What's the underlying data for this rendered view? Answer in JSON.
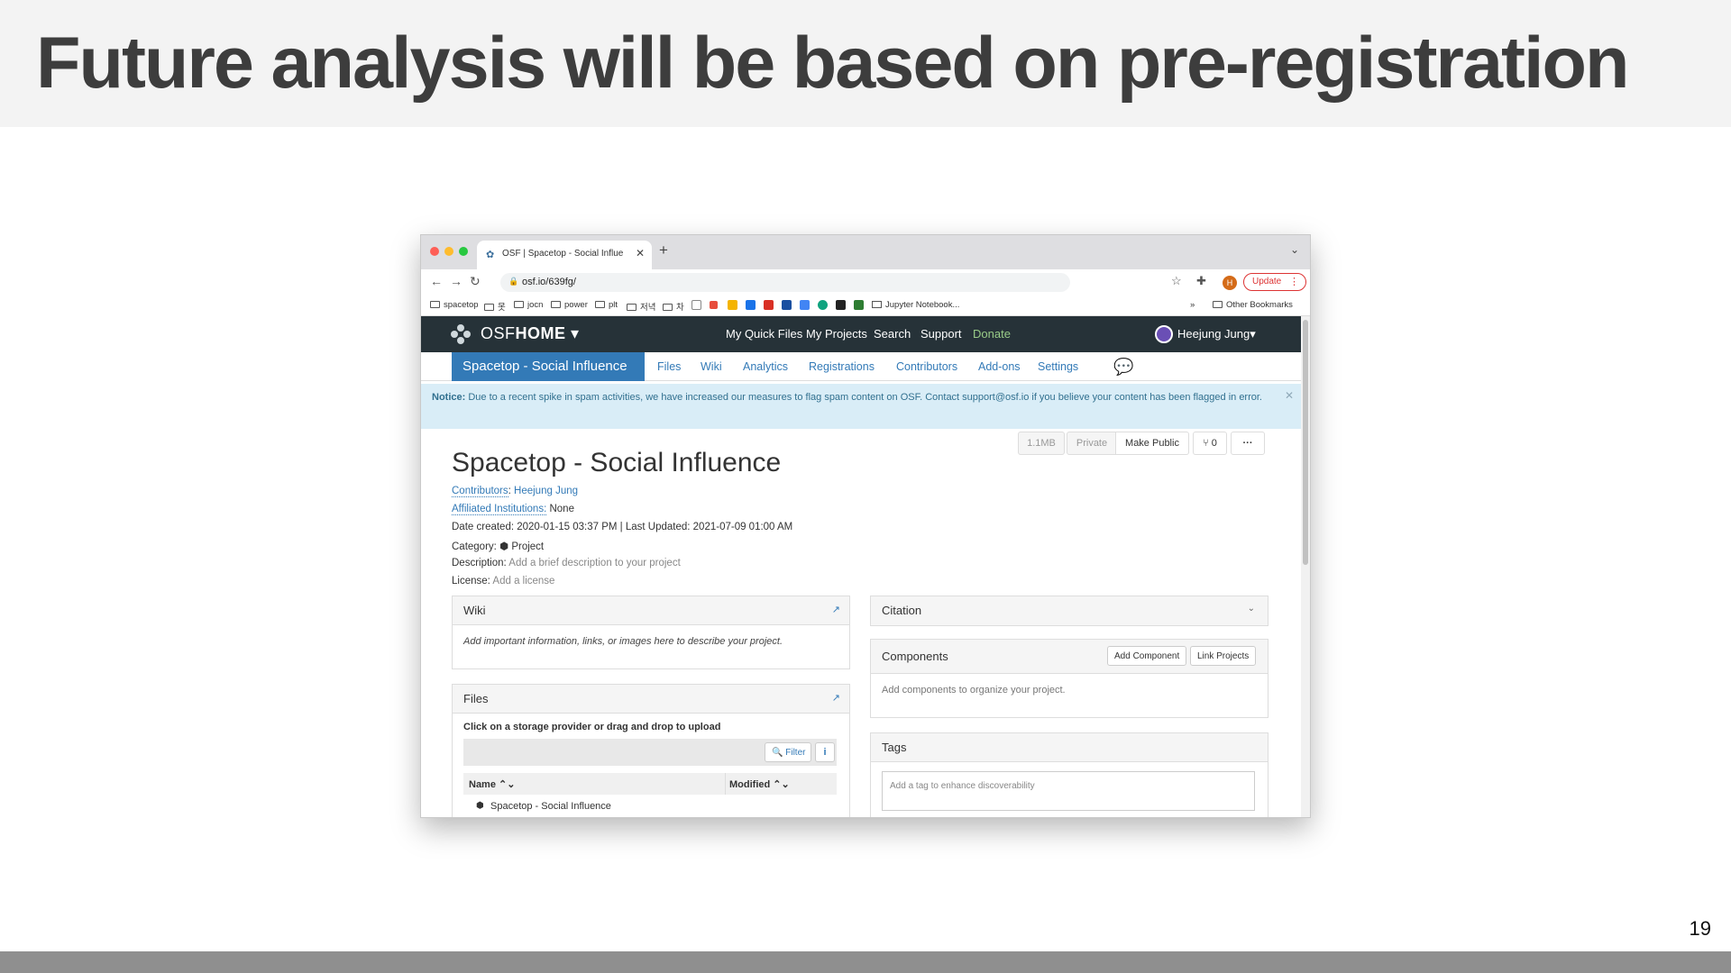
{
  "slide": {
    "title": "Future analysis will be based on pre-registration",
    "page_number": "19"
  },
  "browser": {
    "tab_title": "OSF | Spacetop - Social Influe",
    "url": "osf.io/639fg/",
    "avatar_letter": "H",
    "update_label": "Update",
    "bookmarks": [
      "spacetop",
      "못",
      "jocn",
      "power",
      "plt",
      "저녁",
      "차",
      "Jupyter Notebook...",
      "Other Bookmarks"
    ],
    "bookmarks_overflow": "»"
  },
  "osf": {
    "brand_light": "OSF",
    "brand_bold": "HOME",
    "nav": [
      "My Quick Files",
      "My Projects",
      "Search",
      "Support",
      "Donate"
    ],
    "user_name": "Heejung Jung",
    "project_tab": "Spacetop - Social Influence",
    "project_links": [
      "Files",
      "Wiki",
      "Analytics",
      "Registrations",
      "Contributors",
      "Add-ons",
      "Settings"
    ],
    "notice_label": "Notice:",
    "notice_text": "Due to a recent spike in spam activities, we have increased our measures to flag spam content on OSF. Contact support@osf.io if you believe your content has been flagged in error.",
    "project_title": "Spacetop - Social Influence",
    "size_label": "1.1MB",
    "private_label": "Private",
    "make_public_label": "Make Public",
    "fork_count": "0",
    "more_label": "···",
    "contributors_label": "Contributors",
    "contributor_name": "Heejung Jung",
    "affiliated_label": "Affiliated Institutions:",
    "affiliated_value": "None",
    "dates": "Date created: 2020-01-15 03:37 PM | Last Updated: 2021-07-09 01:00 AM",
    "category_label": "Category:",
    "category_value": "Project",
    "description_label": "Description:",
    "description_value": "Add a brief description to your project",
    "license_label": "License:",
    "license_value": "Add a license",
    "wiki_title": "Wiki",
    "wiki_body": "Add important information, links, or images here to describe your project.",
    "files_title": "Files",
    "files_instructions": "Click on a storage provider or drag and drop to upload",
    "filter_label": "Filter",
    "info_label": "i",
    "col_name": "Name",
    "col_modified": "Modified",
    "file_row": "Spacetop - Social Influence",
    "citation_title": "Citation",
    "components_title": "Components",
    "add_component_label": "Add Component",
    "link_projects_label": "Link Projects",
    "components_body": "Add components to organize your project.",
    "tags_title": "Tags",
    "tags_placeholder": "Add a tag to enhance discoverability"
  },
  "colors": {
    "title_band": "#f3f3f3",
    "osf_nav": "#263238",
    "osf_primary": "#337ab7",
    "notice_bg": "#d9edf7",
    "donate": "#99cc88",
    "bottom_bar": "#8f8f8f"
  }
}
